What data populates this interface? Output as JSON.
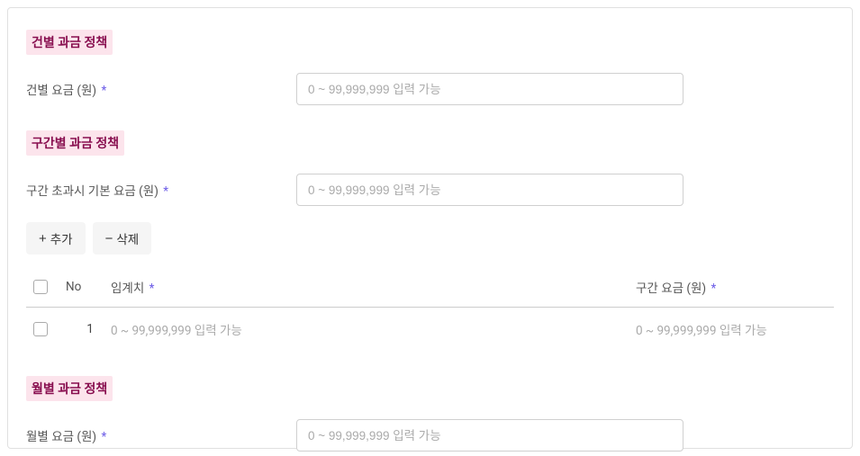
{
  "sections": {
    "perCase": {
      "title": "건별 과금 정책",
      "feeLabel": "건별 요금 (원)",
      "feePlaceholder": "0 ~ 99,999,999 입력 가능"
    },
    "tiered": {
      "title": "구간별 과금 정책",
      "baseFeeLabel": "구간 초과시 기본 요금 (원)",
      "baseFeePlaceholder": "0 ~ 99,999,999 입력 가능",
      "addButton": "추가",
      "deleteButton": "삭제",
      "table": {
        "headers": {
          "no": "No",
          "threshold": "임계치",
          "rangeFee": "구간 요금 (원)"
        },
        "rows": [
          {
            "no": "1",
            "thresholdPlaceholder": "0 ~ 99,999,999 입력 가능",
            "rangeFeePlaceholder": "0 ~ 99,999,999 입력 가능"
          }
        ]
      }
    },
    "monthly": {
      "title": "월별 과금 정책",
      "feeLabel": "월별 요금 (원)",
      "feePlaceholder": "0 ~ 99,999,999 입력 가능"
    }
  },
  "requiredMark": "*"
}
